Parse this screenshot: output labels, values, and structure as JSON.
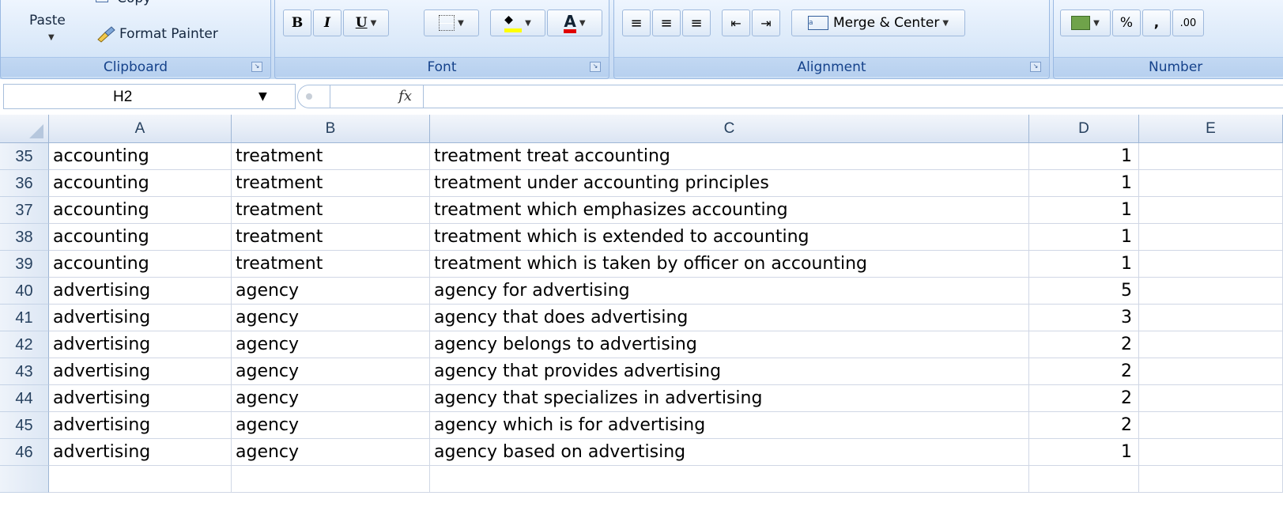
{
  "ribbon": {
    "clipboard": {
      "label": "Clipboard",
      "paste": "Paste",
      "copy": "Copy",
      "format_painter": "Format Painter"
    },
    "font": {
      "label": "Font",
      "bold": "B",
      "italic": "I",
      "underline": "U",
      "font_color": "A"
    },
    "alignment": {
      "label": "Alignment",
      "merge_center": "Merge & Center"
    },
    "number": {
      "label": "Number",
      "percent": "%",
      "comma": ",",
      "increase_decimal": ".00"
    }
  },
  "formula_bar": {
    "name_box": "H2",
    "fx_label": "fx",
    "value": ""
  },
  "grid": {
    "columns": [
      "A",
      "B",
      "C",
      "D",
      "E"
    ],
    "rows": [
      {
        "num": "35",
        "a": "accounting",
        "b": "treatment",
        "c": "treatment treat accounting",
        "d": "1"
      },
      {
        "num": "36",
        "a": "accounting",
        "b": "treatment",
        "c": "treatment under accounting principles",
        "d": "1"
      },
      {
        "num": "37",
        "a": "accounting",
        "b": "treatment",
        "c": "treatment which emphasizes accounting",
        "d": "1"
      },
      {
        "num": "38",
        "a": "accounting",
        "b": "treatment",
        "c": "treatment which is extended to accounting",
        "d": "1"
      },
      {
        "num": "39",
        "a": "accounting",
        "b": "treatment",
        "c": "treatment which is taken by officer on accounting",
        "d": "1"
      },
      {
        "num": "40",
        "a": "advertising",
        "b": "agency",
        "c": "agency for advertising",
        "d": "5"
      },
      {
        "num": "41",
        "a": "advertising",
        "b": "agency",
        "c": "agency that does advertising",
        "d": "3"
      },
      {
        "num": "42",
        "a": "advertising",
        "b": "agency",
        "c": "agency belongs to advertising",
        "d": "2"
      },
      {
        "num": "43",
        "a": "advertising",
        "b": "agency",
        "c": "agency that provides advertising",
        "d": "2"
      },
      {
        "num": "44",
        "a": "advertising",
        "b": "agency",
        "c": "agency that specializes in advertising",
        "d": "2"
      },
      {
        "num": "45",
        "a": "advertising",
        "b": "agency",
        "c": "agency which is for advertising",
        "d": "2"
      },
      {
        "num": "46",
        "a": "advertising",
        "b": "agency",
        "c": "agency based on advertising",
        "d": "1"
      }
    ]
  },
  "colors": {
    "ribbon_text": "#15428b",
    "header_bg": "#dbe5f3",
    "gridline": "#d0d7e5"
  }
}
